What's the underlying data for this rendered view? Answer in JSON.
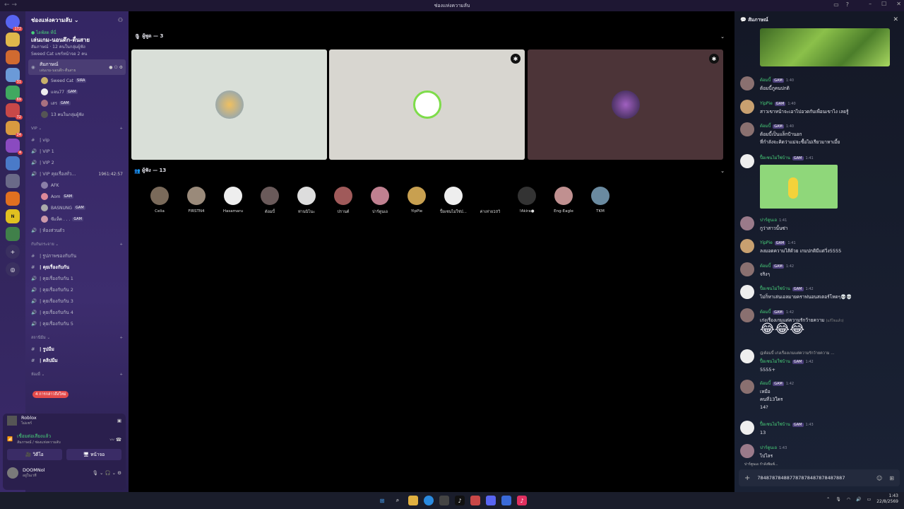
{
  "window": {
    "title": "ช่องแห่งความลับ",
    "nav": "← →"
  },
  "guilds": {
    "badges": [
      "172",
      "",
      "",
      "31",
      "69",
      "72",
      "24",
      "4",
      "",
      "",
      "",
      ""
    ]
  },
  "server": {
    "name": "ช่องแห่งความลับ"
  },
  "event": {
    "live_label": "● ไลฟ์สด ที่นี่",
    "title": "เล่นเกม-นอนดึก-ตื่นสาย",
    "line1": "สัมภาษณ์ · 12 คนในกลุ่มผู้ฟัง",
    "line2": "Sweed Cat แชร์หน้าจอ 2 คน"
  },
  "active_channel": {
    "name": "สัมภาษณ์",
    "sub": "เล่นเกม-นอนดึก-ตื่นสาย"
  },
  "voice_users": [
    {
      "name": "Sweed Cat",
      "tag": "SIRA"
    },
    {
      "name": "แจน77",
      "tag": "GAM"
    },
    {
      "name": "เสร",
      "tag": "GAM"
    },
    {
      "name": "13 คนในกลุ่มผู้ฟัง",
      "tag": ""
    }
  ],
  "vip_category": "VIP",
  "vip_channels": [
    "| vip",
    "| VIP 1",
    "| VIP 2",
    "| VIP คุยเรื่องทั่ว..."
  ],
  "vip_timer": "1961:42:57",
  "vip_users": [
    {
      "name": "AFK",
      "tag": ""
    },
    {
      "name": "Aom",
      "tag": "GAM"
    },
    {
      "name": "BASNUNG",
      "tag": "GAM"
    },
    {
      "name": "ซีแท็ค . . .",
      "tag": "GAM"
    }
  ],
  "private_room": "| ห้องส่วนตัว",
  "friend_category": "กับกันกระจาย",
  "friend_channels": [
    "| รูปภาพของกับกัน",
    "| คุยเรื่องกับกัน",
    "| คุยเรื่องกับกัน 1",
    "| คุยเรื่องกับกัน 2",
    "| คุยเรื่องกับกัน 3",
    "| คุยเรื่องกับกัน 4",
    "| คุยเรื่องกับกัน 5"
  ],
  "meme_category": "สถานีมีม",
  "meme_channels": [
    "| รูปมีม",
    "| คลิปมีม"
  ],
  "other_category": "ห้องอื่",
  "notif_pill": "4 การกล่าวถึงใหม่",
  "userpanel": {
    "activity": "Roblox",
    "activity_sub": "ไม่แชร์",
    "connected": "เชื่อมต่อเสียงแล้ว",
    "connected_sub": "สัมภาษณ์ / ช่องแห่งความลับ",
    "video_btn": "วิดีโอ",
    "screen_btn": "หน้าจอ",
    "username": "DOOMNol",
    "status": "อยู่ในเวที"
  },
  "stage": {
    "speakers_label": "ผู้พูด — 3",
    "listeners_label": "ผู้ฟัง — 13",
    "listeners": [
      "Celia",
      "FIRSTN4",
      "Hasamaru",
      "ต้อมบี้",
      "ท่านนิโนะ",
      "ปรานต์",
      "ปาร์ตูนเอ",
      "YipPie",
      "ปื้อเซนไม่ใช่ป่...",
      "ค่าเท่าย10วิ",
      "!Akira●",
      "Eng-Eagle",
      "TKM"
    ]
  },
  "chat": {
    "title": "สัมภาษณ์",
    "messages": [
      {
        "name": "ต้อมบี้",
        "tag": "GAM",
        "time": "1:40",
        "text": "ต้อมบี้ภูคนปกติ"
      },
      {
        "name": "YipPie",
        "tag": "GAM",
        "time": "1:40",
        "text": "สาวเขาหน้าจะเอาไปอวดกับเพื่อนเขาไง เลยรู้"
      },
      {
        "name": "ต้อมบี้",
        "tag": "GAM",
        "time": "1:40",
        "text": "ต้อมบี้เป็นแล็กป้านอก",
        "text2": "ที่กำลังจะคิดว่าแม่จะซื้อไม่เรียวมาหาเมี้ย"
      },
      {
        "name": "ปื้อเซนไม่ใช่บ้าน",
        "tag": "GAM",
        "time": "1:41",
        "text": ""
      },
      {
        "name": "ปาร์ตูนเอ",
        "tag": "",
        "time": "1:41",
        "text": "กูว่าสาวนั้นซ่า"
      },
      {
        "name": "YipPie",
        "tag": "GAM",
        "time": "1:41",
        "text": "ลงมอดความไส้ด้วย เกมปกติมีแต่วิ่ง5555"
      },
      {
        "name": "ต้อมบี้",
        "tag": "GAM",
        "time": "1:42",
        "text": "จริงๆ"
      },
      {
        "name": "ปื้อเซนไม่ใช่บ้าน",
        "tag": "GAM",
        "time": "1:42",
        "text": "ไม่ก็หาเล่นเอลมายคราฟนอนสเตอร์โหดๆ💀💀"
      },
      {
        "name": "ต้อมบี้",
        "tag": "GAM",
        "time": "1:42",
        "text": "เก่งเรื่องเกมแต่ความรักว้ายความ",
        "edited": "(แก้ไขแล้ว)"
      },
      {
        "name": "ปื้อเซนไม่ใช่บ้าน",
        "tag": "GAM",
        "time": "1:42",
        "text": "5555+",
        "reply": "@ต้อมบี้ เก่งเรื่องเกมแต่ความรักว้ายความ ..."
      },
      {
        "name": "ต้อมบี้",
        "tag": "GAM",
        "time": "1:42",
        "text": "เหมือ",
        "text2": "คนที่13ใคร",
        "text3": "14?"
      },
      {
        "name": "ปื้อเซนไม่ใช่บ้าน",
        "tag": "GAM",
        "time": "1:43",
        "text": "13"
      },
      {
        "name": "ปาร์ตูนเอ",
        "tag": "",
        "time": "1:43",
        "text": "ไปไลร"
      }
    ],
    "emojis": "😂😂😂",
    "typing": "ปาร์ตูนเอ กำลังพิมพ์...",
    "input_value": "784878784887787878487878487887"
  },
  "taskbar": {
    "time": "1:43",
    "date": "22/8/2569"
  },
  "colors": {
    "accent": "#48d17a",
    "sidebar": "#3d2d6e",
    "chat_bg": "#1a2235"
  }
}
